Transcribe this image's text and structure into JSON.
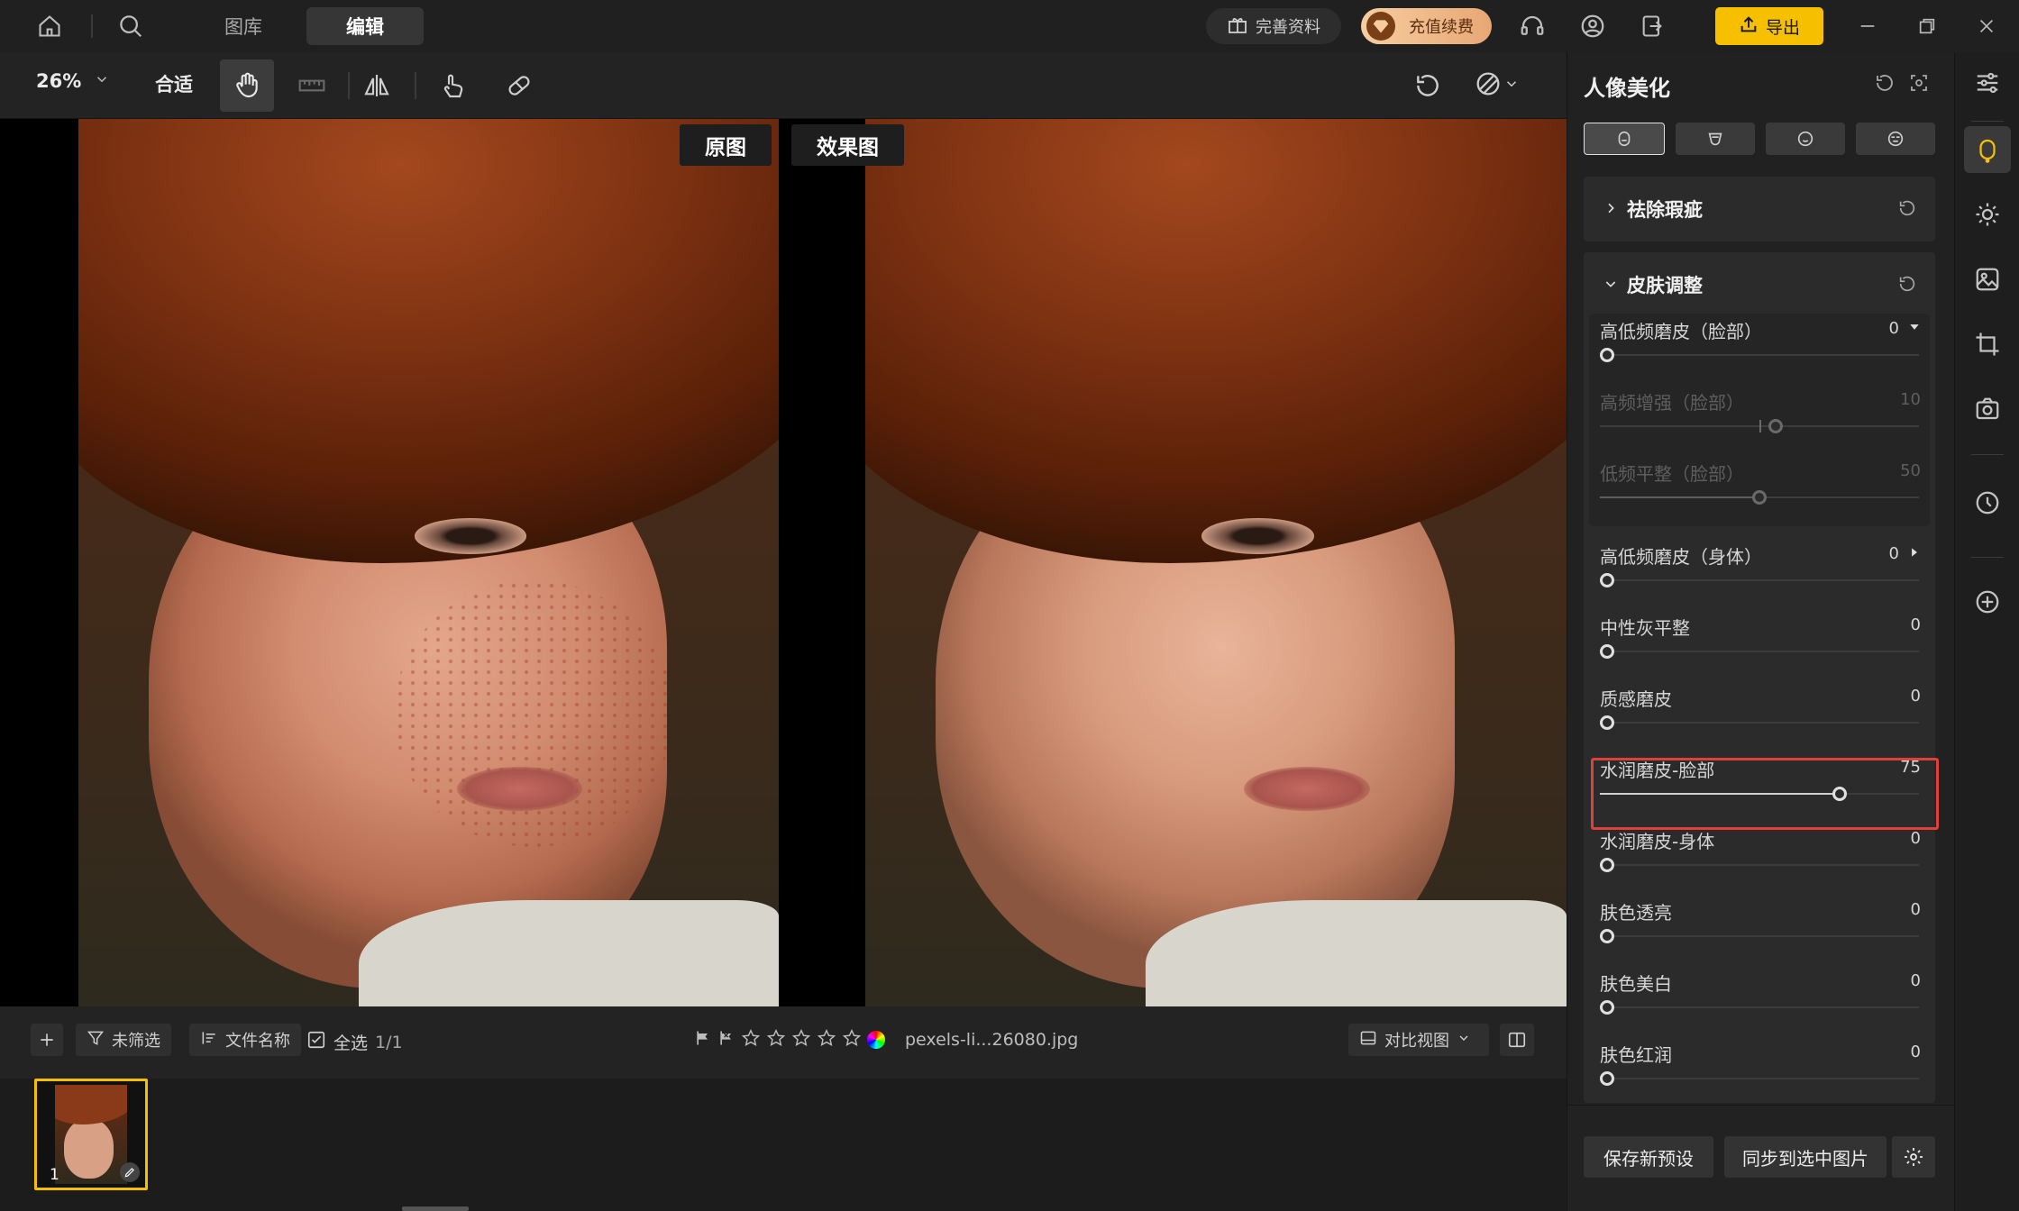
{
  "topbar": {
    "tab_library": "图库",
    "tab_edit": "编辑",
    "profile_label": "完善资料",
    "vip_label": "充值续费",
    "export_label": "导出"
  },
  "toolbar": {
    "zoom": "26%",
    "fit": "合适"
  },
  "viewer": {
    "before_label": "原图",
    "after_label": "效果图"
  },
  "filmstrip": {
    "filter_label": "未筛选",
    "sort_label": "文件名称",
    "select_all_label": "全选",
    "select_count": "1/1",
    "file_name": "pexels-li...26080.jpg",
    "compare_label": "对比视图",
    "thumb_index": "1",
    "stars_total": 5
  },
  "panel": {
    "title": "人像美化",
    "section_blemish": "祛除瑕疵",
    "section_skin": "皮肤调整",
    "sliders": [
      {
        "label": "高低频磨皮（脸部）",
        "value": "0",
        "fraction": 0.0,
        "arrow": "down"
      },
      {
        "label": "高频增强（脸部）",
        "value": "10",
        "fraction": 0.55,
        "disabled": true,
        "centered": true
      },
      {
        "label": "低频平整（脸部）",
        "value": "50",
        "fraction": 0.5,
        "disabled": true
      },
      {
        "label": "高低频磨皮（身体）",
        "value": "0",
        "fraction": 0.0,
        "arrow": "right"
      },
      {
        "label": "中性灰平整",
        "value": "0",
        "fraction": 0.0
      },
      {
        "label": "质感磨皮",
        "value": "0",
        "fraction": 0.0
      },
      {
        "label": "水润磨皮-脸部",
        "value": "75",
        "fraction": 0.75,
        "highlighted": true
      },
      {
        "label": "水润磨皮-身体",
        "value": "0",
        "fraction": 0.0
      },
      {
        "label": "肤色透亮",
        "value": "0",
        "fraction": 0.0
      },
      {
        "label": "肤色美白",
        "value": "0",
        "fraction": 0.0
      },
      {
        "label": "肤色红润",
        "value": "0",
        "fraction": 0.0
      }
    ],
    "save_preset": "保存新预设",
    "sync_selected": "同步到选中图片"
  },
  "colors": {
    "accent": "#f6c000",
    "highlight": "#e0403a",
    "vip_gradient_start": "#f7cda0"
  }
}
